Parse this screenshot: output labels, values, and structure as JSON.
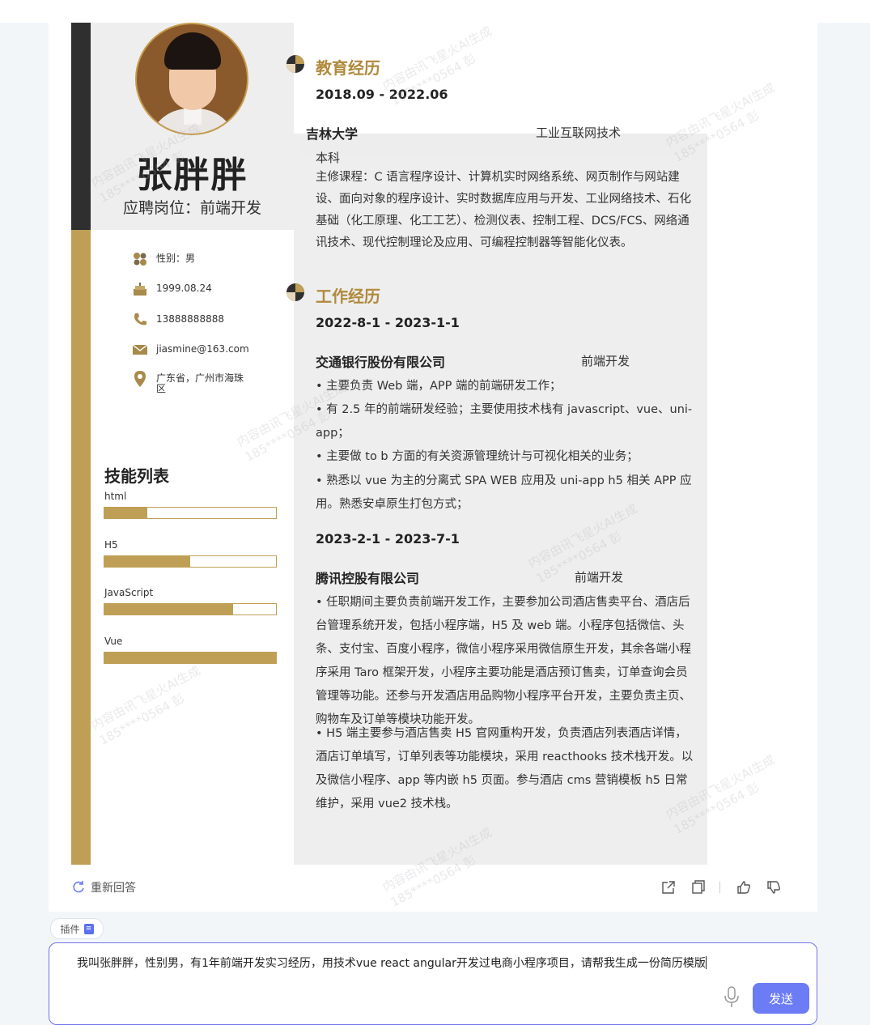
{
  "resume": {
    "name": "张胖胖",
    "job": "应聘岗位：前端开发",
    "info": [
      {
        "icon": "gender-icon",
        "text": "性别：男"
      },
      {
        "icon": "birthday-cake-icon",
        "text": "1999.08.24"
      },
      {
        "icon": "phone-icon",
        "text": "13888888888"
      },
      {
        "icon": "email-icon",
        "text": "jiasmine@163.com"
      },
      {
        "icon": "location-pin-icon",
        "text": "广东省，广州市海珠区"
      }
    ],
    "skills_title": "技能列表",
    "skills": [
      {
        "name": "html",
        "level": 0.25
      },
      {
        "name": "H5",
        "level": 0.5
      },
      {
        "name": "JavaScript",
        "level": 0.75
      },
      {
        "name": "Vue",
        "level": 1.0
      }
    ],
    "education": {
      "title": "教育经历",
      "date": "2018.09 - 2022.06",
      "school": "吉林大学",
      "major": "工业互联网技术",
      "degree": "本科",
      "courses": "主修课程：C 语言程序设计、计算机实时网络系统、网页制作与网站建设、面向对象的程序设计、实时数据库应用与开发、工业网络技术、石化基础（化工原理、化工工艺）、检测仪表、控制工程、DCS/FCS、网络通讯技术、现代控制理论及应用、可编程控制器等智能化仪表。"
    },
    "work": {
      "title": "工作经历",
      "jobs": [
        {
          "date": "2022-8-1 - 2023-1-1",
          "company": "交通银行股份有限公司",
          "position": "前端开发",
          "bullets": [
            "•   主要负责 Web 端，APP 端的前端研发工作；",
            "•   有 2.5 年的前端研发经验；主要使用技术栈有 javascript、vue、uni-app；",
            "•   主要做 to b 方面的有关资源管理统计与可视化相关的业务；",
            "•   熟悉以 vue 为主的分离式 SPA WEB 应用及 uni-app h5 相关 APP 应用。熟悉安卓原生打包方式；"
          ]
        },
        {
          "date": "2023-2-1 - 2023-7-1",
          "company": "腾讯控股有限公司",
          "position": "前端开发",
          "bullets": [
            "•   任职期间主要负责前端开发工作，主要参加公司酒店售卖平台、酒店后台管理系统开发，包括小程序端，H5 及 web 端。小程序包括微信、头条、支付宝、百度小程序，微信小程序采用微信原生开发，其余各端小程序采用 Taro 框架开发，小程序主要功能是酒店预订售卖，订单查询会员管理等功能。还参与开发酒店用品购物小程序平台开发，主要负责主页、购物车及订单等模块功能开发。",
            "•   H5 端主要参与酒店售卖 H5 官网重构开发，负责酒店列表酒店详情，酒店订单填写，订单列表等功能模块，采用 reacthooks 技术栈开发。以及微信小程序、app 等内嵌 h5 页面。参与酒店 cms 营销模板 h5 日常维护，采用 vue2 技术栈。"
          ]
        }
      ]
    }
  },
  "watermark": {
    "line1": "内容由讯飞星火AI生成",
    "line2": "185****0564 彭"
  },
  "actions": {
    "regenerate": "重新回答"
  },
  "plugin_label": "插件",
  "input": {
    "text": "我叫张胖胖，性别男，有1年前端开发实习经历，用技术vue react angular开发过电商小程序项目，请帮我生成一份简历模版"
  },
  "send_label": "发送",
  "colors": {
    "gold": "#bf9f55",
    "accent": "#6b7cf5",
    "dark": "#2f2f2f"
  }
}
